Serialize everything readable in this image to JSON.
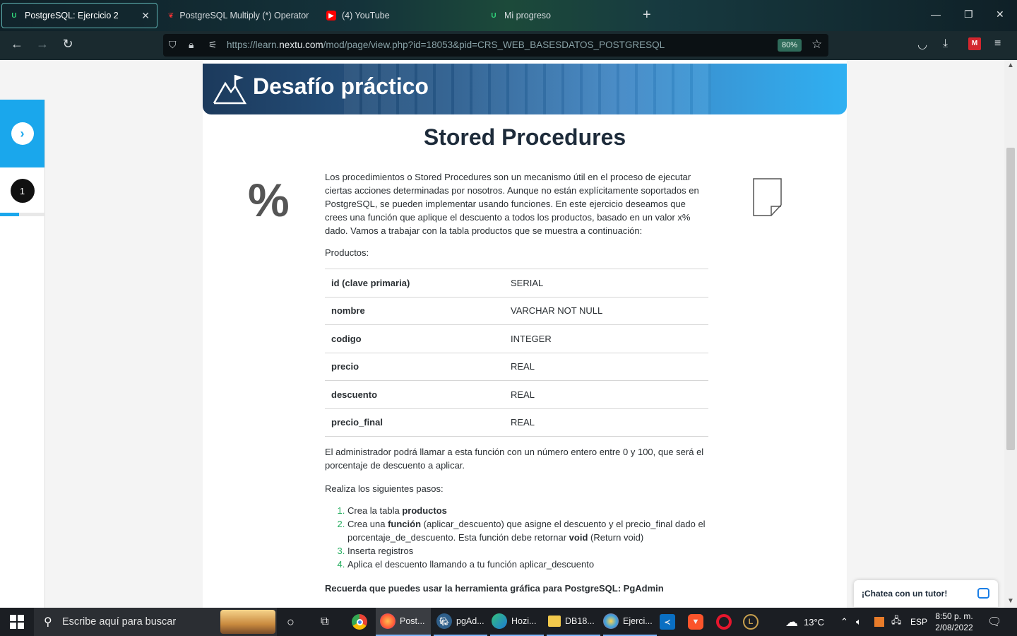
{
  "browser": {
    "tabs": [
      {
        "label": "PostgreSQL: Ejercicio 2",
        "active": true,
        "icon": "nextu-favicon"
      },
      {
        "label": "PostgreSQL Multiply (*) Operator",
        "active": false,
        "icon": "postgres-favicon"
      },
      {
        "label": "(4) YouTube",
        "active": false,
        "icon": "youtube-favicon"
      },
      {
        "label": "Mi progreso",
        "active": false,
        "icon": "nextu-favicon"
      }
    ],
    "url_prefix": "https://learn.",
    "url_domain": "nextu.com",
    "url_path": "/mod/page/view.php?id=18053&pid=CRS_WEB_BASESDATOS_POSTGRESQL",
    "zoom": "80%"
  },
  "sidepanel": {
    "step_number": "1",
    "progress": 0.42
  },
  "banner": {
    "title": "Desafío práctico"
  },
  "content": {
    "heading": "Stored Procedures",
    "percent_symbol": "%",
    "intro": "Los procedimientos o Stored Procedures son un mecanismo útil en el proceso de ejecutar ciertas acciones determinadas por nosotros. Aunque no están explícitamente soportados en PostgreSQL, se pueden implementar usando funciones. En este ejercicio deseamos que crees una función que aplique el descuento a todos los productos, basado en un valor x% dado. Vamos a trabajar con la tabla productos que se muestra a continuación:",
    "productos_label": "Productos:",
    "table": [
      {
        "field": "id (clave primaria)",
        "type": "SERIAL"
      },
      {
        "field": "nombre",
        "type": "VARCHAR NOT NULL"
      },
      {
        "field": "codigo",
        "type": "INTEGER"
      },
      {
        "field": "precio",
        "type": "REAL"
      },
      {
        "field": "descuento",
        "type": "REAL"
      },
      {
        "field": "precio_final",
        "type": "REAL"
      }
    ],
    "admin_text": "El administrador podrá llamar a esta función con un número entero entre 0 y 100, que será el porcentaje de descuento a aplicar.",
    "steps_intro": "Realiza los siguientes pasos:",
    "steps": {
      "s1_pre": "Crea la tabla ",
      "s1_bold": "productos",
      "s2_pre": "Crea una ",
      "s2_bold": "función",
      "s2_mid": " (aplicar_descuento) que asigne el descuento y el precio_final dado el porcentaje_de_descuento. Esta función debe retornar ",
      "s2_bold2": "void",
      "s2_post": " (Return void)",
      "s3": "Inserta registros",
      "s4": "Aplica el descuento llamando a tu función aplicar_descuento"
    },
    "reminder": "Recuerda que puedes usar la herramienta gráfica para PostgreSQL: PgAdmin"
  },
  "chat": {
    "label": "¡Chatea con un tutor!"
  },
  "taskbar": {
    "search_placeholder": "Escribe aquí para buscar",
    "apps": [
      {
        "label": "Post...",
        "icon": "firefox-icon"
      },
      {
        "label": "pgAd...",
        "icon": "pgadmin-icon"
      },
      {
        "label": "Hozi...",
        "icon": "edge-icon"
      },
      {
        "label": "DB18...",
        "icon": "folder-icon"
      },
      {
        "label": "Ejerci...",
        "icon": "paint-icon"
      }
    ],
    "weather": "13°C",
    "language": "ESP",
    "time": "8:50 p. m.",
    "date": "2/08/2022"
  }
}
